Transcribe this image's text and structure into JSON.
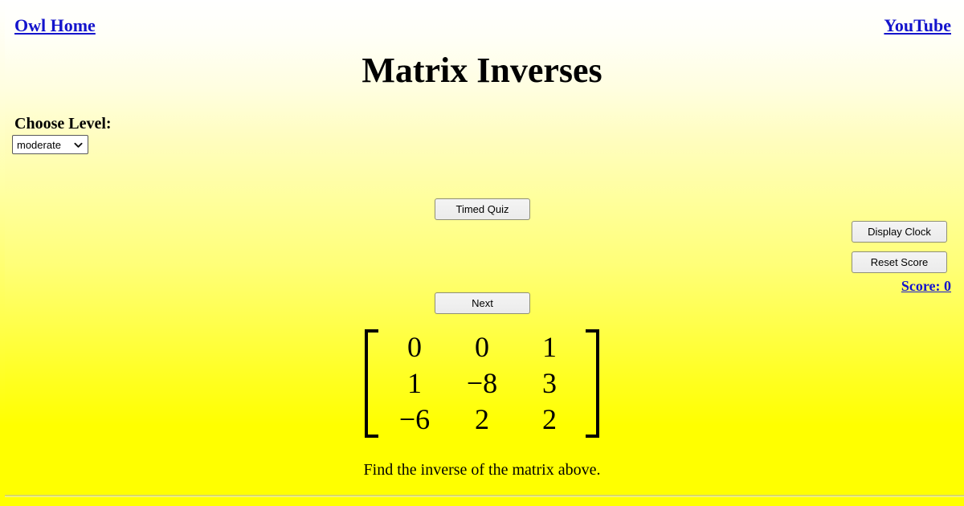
{
  "nav": {
    "home_label": "Owl Home",
    "youtube_label": "YouTube",
    "link_color": "#1414cc"
  },
  "header": {
    "title": "Matrix Inverses"
  },
  "level": {
    "label": "Choose Level:",
    "selected": "moderate",
    "options": [
      "moderate"
    ],
    "chevron_icon": "chevron-down-icon"
  },
  "controls": {
    "timed_quiz_label": "Timed Quiz",
    "next_label": "Next",
    "display_clock_label": "Display Clock",
    "reset_score_label": "Reset Score"
  },
  "score": {
    "label": "Score: 0",
    "value": 0
  },
  "matrix": {
    "rows": [
      [
        "0",
        "0",
        "1"
      ],
      [
        "1",
        "−8",
        "3"
      ],
      [
        "−6",
        "2",
        "2"
      ]
    ],
    "caption": "Find the inverse of the matrix above."
  },
  "theme": {
    "background_top": "#ffffff",
    "background_bottom": "#ffff00",
    "text_color": "#000000",
    "button_face": "#ebebeb",
    "rule_color": "#d8d86a"
  }
}
